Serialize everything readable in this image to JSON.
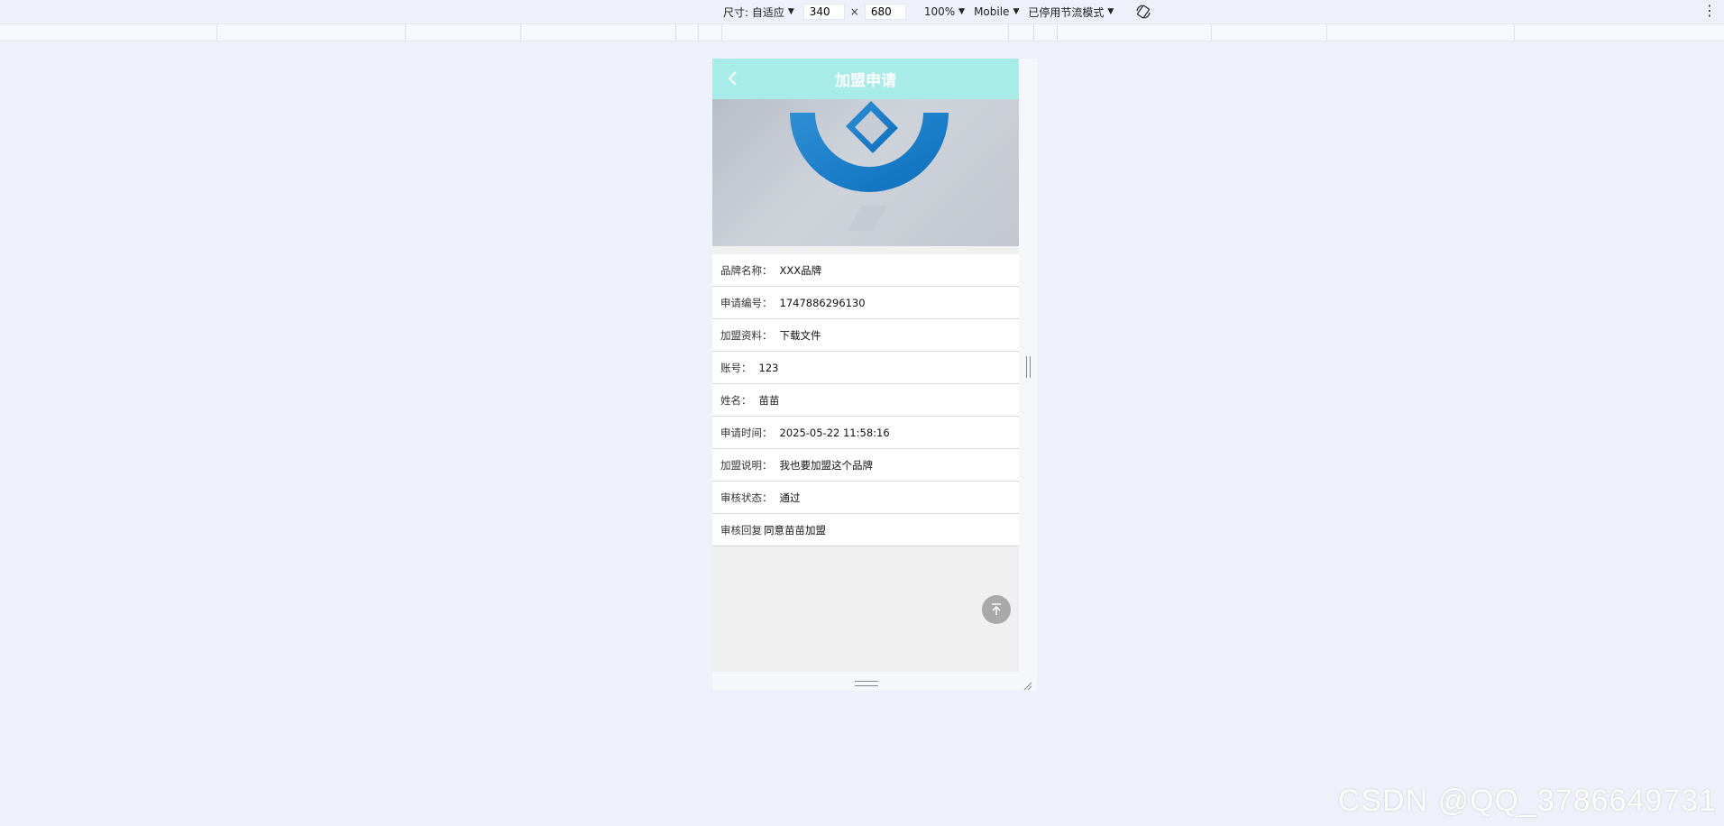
{
  "devtools": {
    "size_label": "尺寸: 自适应",
    "width_value": "340",
    "times": "×",
    "height_value": "680",
    "zoom": "100%",
    "device_type": "Mobile",
    "throttle": "已停用节流模式",
    "more": "⋮"
  },
  "app": {
    "title": "加盟申请",
    "header_color": "#a8ecea"
  },
  "details": [
    {
      "label": "品牌名称：",
      "value": "XXX品牌"
    },
    {
      "label": "申请编号：",
      "value": "1747886296130"
    },
    {
      "label": "加盟资料：",
      "value": "下载文件"
    },
    {
      "label": "账号：",
      "value": "123"
    },
    {
      "label": "姓名：",
      "value": "苗苗"
    },
    {
      "label": "申请时间：",
      "value": "2025-05-22 11:58:16"
    },
    {
      "label": "加盟说明：",
      "value": "我也要加盟这个品牌"
    },
    {
      "label": "审核状态：",
      "value": "通过"
    },
    {
      "label": "审核回复",
      "value": "同意苗苗加盟"
    }
  ],
  "icons": {
    "back": "chevron-left-icon",
    "to_top": "arrow-up-to-top-icon",
    "rotate": "rotate-icon"
  },
  "watermark": "CSDN @QQ_3786649731"
}
